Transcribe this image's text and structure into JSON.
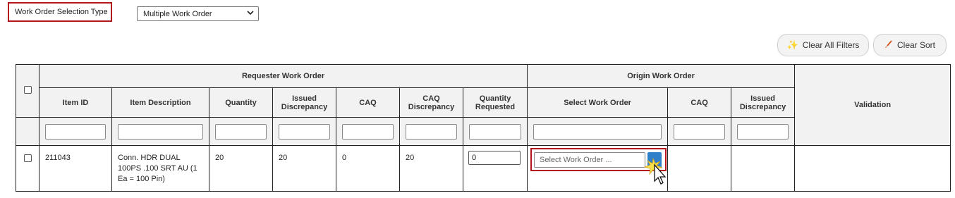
{
  "selection_type": {
    "label": "Work Order Selection Type",
    "value": "Multiple Work Order"
  },
  "toolbar": {
    "clear_filters_label": "Clear All Filters",
    "clear_sort_label": "Clear Sort"
  },
  "table": {
    "group_headers": {
      "requester": "Requester Work Order",
      "origin": "Origin Work Order",
      "validation": "Validation"
    },
    "columns": {
      "item_id": "Item ID",
      "item_description": "Item Description",
      "quantity": "Quantity",
      "issued_discrepancy": "Issued Discrepancy",
      "caq": "CAQ",
      "caq_discrepancy": "CAQ Discrepancy",
      "quantity_requested": "Quantity Requested",
      "select_work_order": "Select Work Order",
      "origin_caq": "CAQ",
      "origin_issued_discrepancy": "Issued Discrepancy"
    },
    "rows": [
      {
        "item_id": "211043",
        "item_description": "Conn. HDR DUAL 100PS .100 SRT AU (1 Ea = 100 Pin)",
        "quantity": "20",
        "issued_discrepancy": "20",
        "caq": "0",
        "caq_discrepancy": "20",
        "quantity_requested": "0",
        "select_work_order_placeholder": "Select Work Order ...",
        "origin_caq": "",
        "origin_issued_discrepancy": "",
        "validation": ""
      }
    ]
  },
  "colors": {
    "highlight_border": "#b3151b",
    "picker_button": "#2f7fc9",
    "header_bg": "#f2f2f2"
  },
  "icons": {
    "clear_filters": "sparkle-icon",
    "clear_sort": "brush-icon",
    "select_chevron": "chevron-down-icon",
    "cursor": "mouse-cursor-icon"
  }
}
